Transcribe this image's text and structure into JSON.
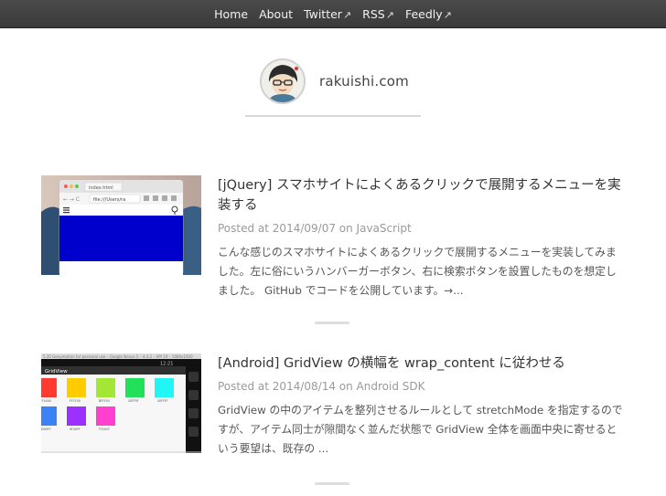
{
  "nav": {
    "items": [
      {
        "label": "Home",
        "external": false
      },
      {
        "label": "About",
        "external": false
      },
      {
        "label": "Twitter",
        "external": true
      },
      {
        "label": "RSS",
        "external": true
      },
      {
        "label": "Feedly",
        "external": true
      }
    ],
    "external_glyph": "↗"
  },
  "site": {
    "name": "rakuishi.com"
  },
  "posts": [
    {
      "title": "[jQuery] スマホサイトによくあるクリックで展開するメニューを実装する",
      "meta_prefix": "Posted at ",
      "date": "2014/09/07",
      "meta_on": " on ",
      "category": "JavaScript",
      "excerpt": "こんな感じのスマホサイトによくあるクリックで展開するメニューを実装してみました。左に俗にいうハンバーガーボタン、右に検索ボタンを設置したものを想定しました。 GitHub でコードを公開しています。→...",
      "thumb": {
        "tab_label": "index.html",
        "url_text": "file:///Users/ra",
        "colors": {
          "bg": "#c9b9b0",
          "sea": "#2e4f72",
          "blue": "#0000cc"
        }
      }
    },
    {
      "title": "[Android] GridView の横幅を wrap_content に従わせる",
      "meta_prefix": "Posted at ",
      "date": "2014/08/14",
      "meta_on": " on ",
      "category": "Android SDK",
      "excerpt": "GridView の中のアイテムを整列させるルールとして stretchMode を指定するのですが、アイテム同士が隙間なく並んだ状態で GridView 全体を画面中央に寄せるという要望は、既存の ...",
      "thumb": {
        "header_text": "GridView",
        "status_text": "12:21",
        "colors": [
          "#ff3b30",
          "#ffcc00",
          "#a3e635",
          "#22e05a",
          "#22f5f5",
          "#3b82f6",
          "#9b30ff",
          "#ff3fd0"
        ],
        "cell_labels": [
          "FF4040",
          "FFCF40",
          "BFFF40",
          "40FF5F",
          "40FFFF",
          "4090FF",
          "9F40FF",
          "FF40CF"
        ]
      }
    }
  ]
}
